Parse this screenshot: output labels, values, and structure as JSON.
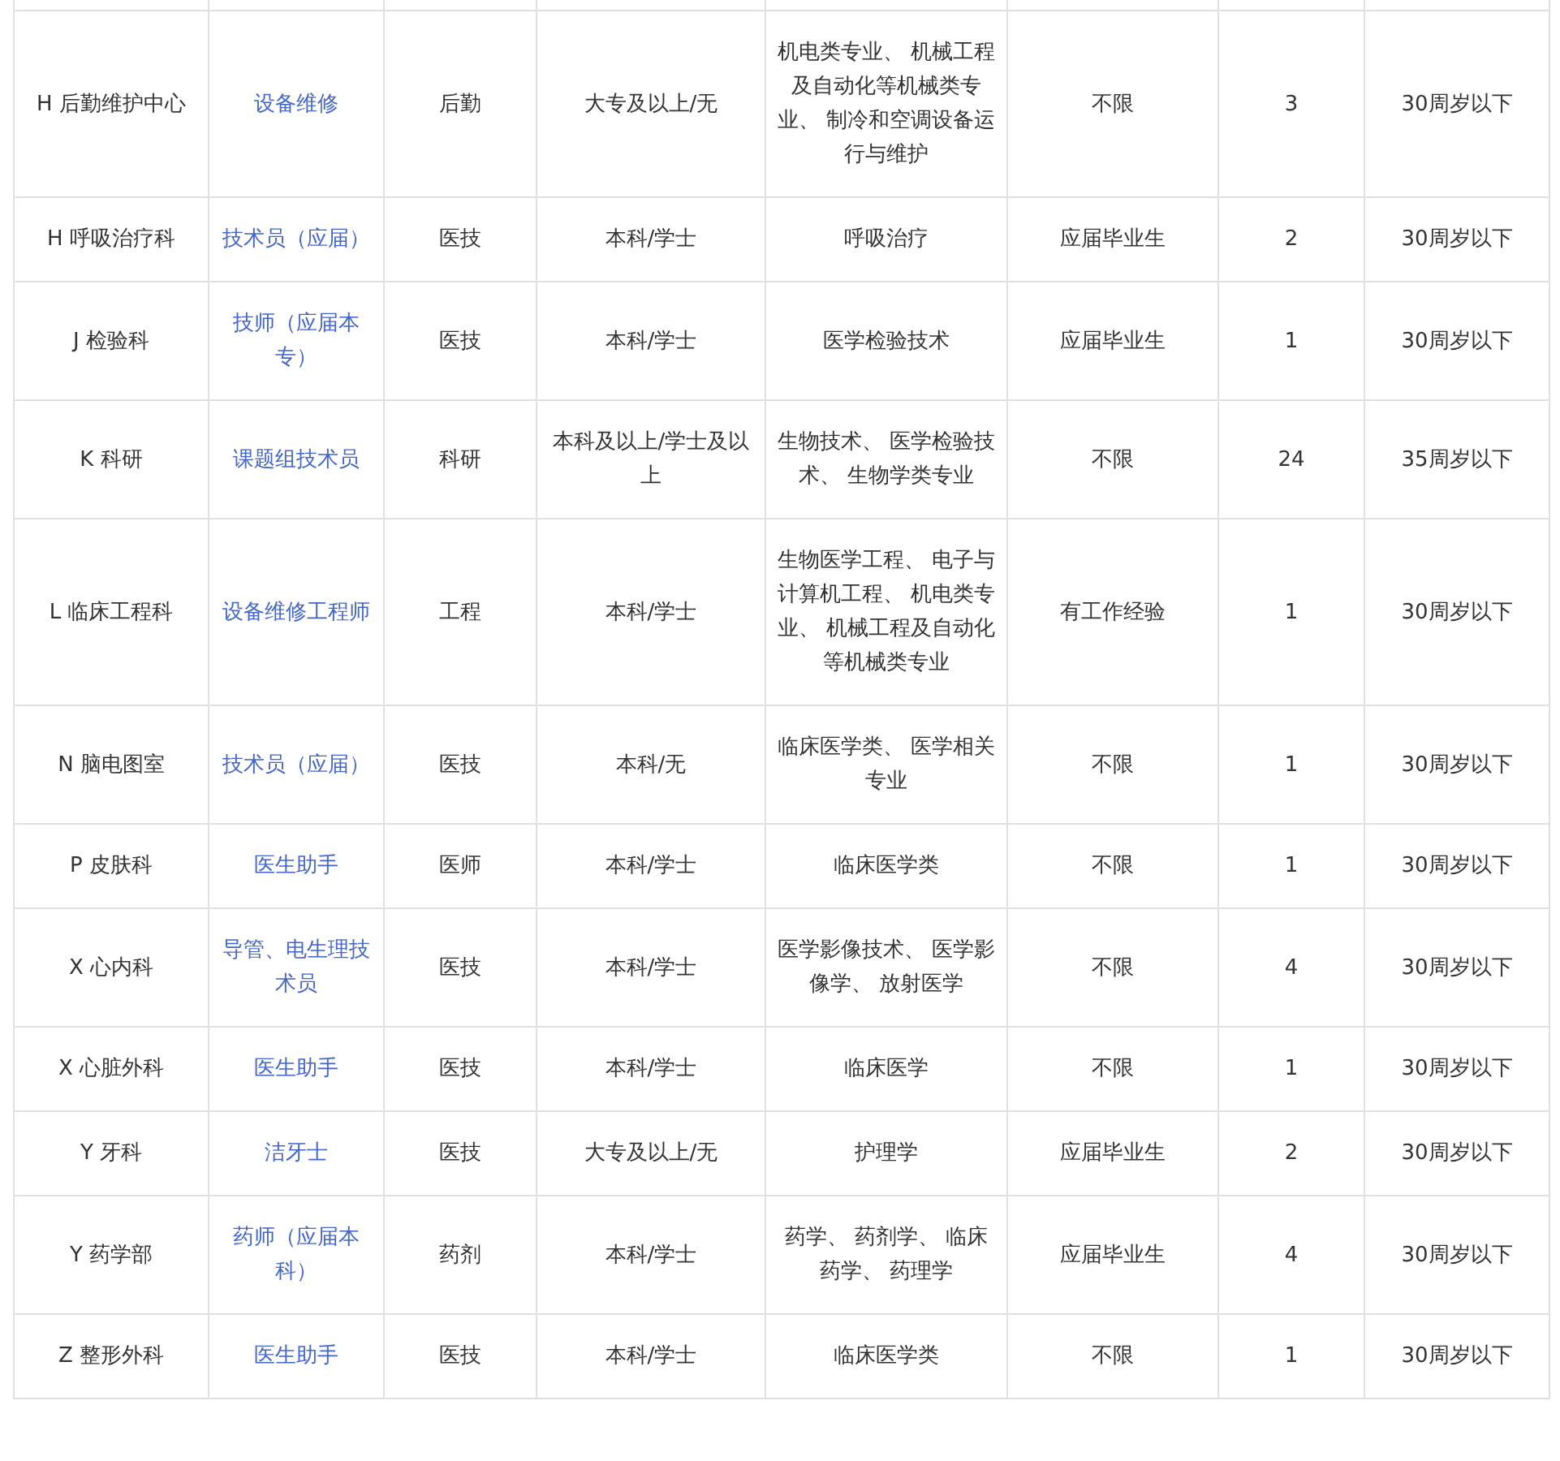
{
  "table": {
    "rows": [
      {
        "cells": [
          "H 后勤维护中心",
          "设备维修",
          "后勤",
          "大专及以上/无",
          "机电类专业、 机械工程及自动化等机械类专业、 制冷和空调设备运行与维护",
          "不限",
          "3",
          "30周岁以下"
        ]
      },
      {
        "cells": [
          "H 呼吸治疗科",
          "技术员（应届）",
          "医技",
          "本科/学士",
          "呼吸治疗",
          "应届毕业生",
          "2",
          "30周岁以下"
        ]
      },
      {
        "cells": [
          "J 检验科",
          "技师（应届本专）",
          "医技",
          "本科/学士",
          "医学检验技术",
          "应届毕业生",
          "1",
          "30周岁以下"
        ]
      },
      {
        "cells": [
          "K 科研",
          "课题组技术员",
          "科研",
          "本科及以上/学士及以上",
          "生物技术、 医学检验技术、 生物学类专业",
          "不限",
          "24",
          "35周岁以下"
        ]
      },
      {
        "cells": [
          "L 临床工程科",
          "设备维修工程师",
          "工程",
          "本科/学士",
          "生物医学工程、 电子与计算机工程、 机电类专业、 机械工程及自动化等机械类专业",
          "有工作经验",
          "1",
          "30周岁以下"
        ]
      },
      {
        "cells": [
          "N 脑电图室",
          "技术员（应届）",
          "医技",
          "本科/无",
          "临床医学类、 医学相关专业",
          "不限",
          "1",
          "30周岁以下"
        ]
      },
      {
        "cells": [
          "P 皮肤科",
          "医生助手",
          "医师",
          "本科/学士",
          "临床医学类",
          "不限",
          "1",
          "30周岁以下"
        ]
      },
      {
        "cells": [
          "X 心内科",
          "导管、电生理技术员",
          "医技",
          "本科/学士",
          "医学影像技术、 医学影像学、 放射医学",
          "不限",
          "4",
          "30周岁以下"
        ]
      },
      {
        "cells": [
          "X 心脏外科",
          "医生助手",
          "医技",
          "本科/学士",
          "临床医学",
          "不限",
          "1",
          "30周岁以下"
        ]
      },
      {
        "cells": [
          "Y 牙科",
          "洁牙士",
          "医技",
          "大专及以上/无",
          "护理学",
          "应届毕业生",
          "2",
          "30周岁以下"
        ]
      },
      {
        "cells": [
          "Y 药学部",
          "药师（应届本科）",
          "药剂",
          "本科/学士",
          "药学、 药剂学、 临床药学、 药理学",
          "应届毕业生",
          "4",
          "30周岁以下"
        ]
      },
      {
        "cells": [
          "Z 整形外科",
          "医生助手",
          "医技",
          "本科/学士",
          "临床医学类",
          "不限",
          "1",
          "30周岁以下"
        ]
      }
    ]
  }
}
